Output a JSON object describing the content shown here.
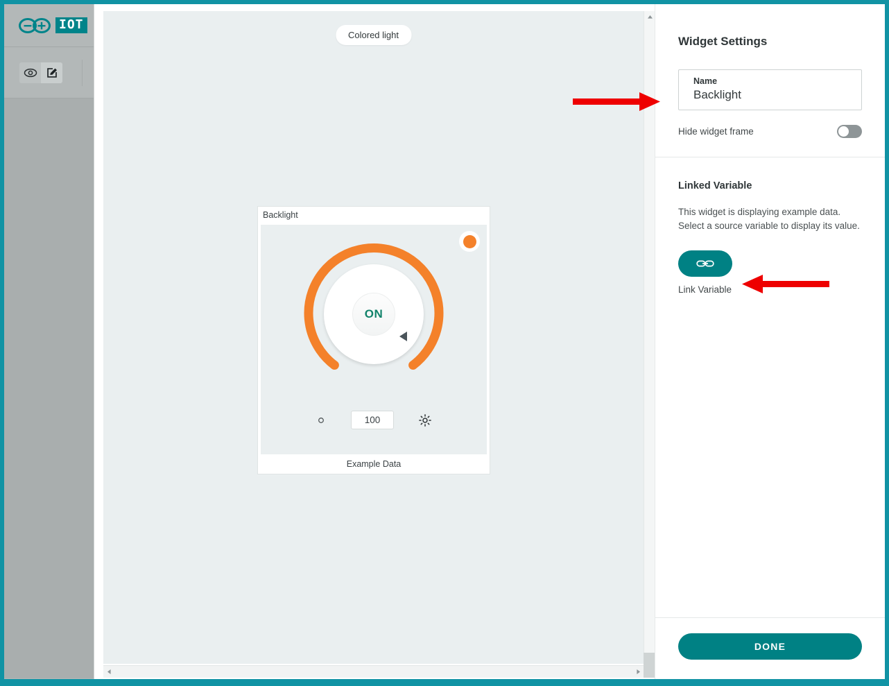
{
  "theme": {
    "teal": "#008184",
    "frame_teal": "#1193a4",
    "orange": "#f4812a",
    "canvas_bg": "#eaeff0",
    "sidebar_bg": "#b3b8b8",
    "annotation_red": "#ee0000"
  },
  "sidebar": {
    "logo_text": "IOT",
    "logo_icon": "arduino-infinity-icon",
    "tools": [
      {
        "name": "preview",
        "icon": "eye-icon",
        "active": false
      },
      {
        "name": "edit",
        "icon": "pencil-edit-icon",
        "active": true
      }
    ]
  },
  "canvas": {
    "chip_label": "Colored light",
    "widget": {
      "title": "Backlight",
      "footer": "Example Data",
      "color_swatch": "#f4812a",
      "dial": {
        "center_label": "ON",
        "value": "100",
        "arc_percent": 100,
        "arc_color": "#f4812a",
        "min_icon": "small-circle-dim-icon",
        "max_icon": "sun-brightness-icon"
      }
    },
    "scrollbars": {
      "v_up_icon": "chevron-up-icon",
      "v_down_icon": "chevron-down-icon",
      "h_left_icon": "chevron-left-icon",
      "h_right_icon": "chevron-right-icon"
    }
  },
  "panel": {
    "title": "Widget Settings",
    "name_field": {
      "label": "Name",
      "value": "Backlight",
      "placeholder": "Name"
    },
    "hide_frame": {
      "label": "Hide widget frame",
      "state": "off"
    },
    "linked_variable": {
      "title": "Linked Variable",
      "description": "This widget is displaying example data. Select a source variable to display its value.",
      "button_icon": "link-chain-icon",
      "button_label": "Link Variable"
    },
    "done_label": "DONE"
  },
  "annotations": [
    {
      "name": "arrow-to-name-field",
      "direction": "right"
    },
    {
      "name": "arrow-to-link-variable",
      "direction": "left"
    }
  ]
}
